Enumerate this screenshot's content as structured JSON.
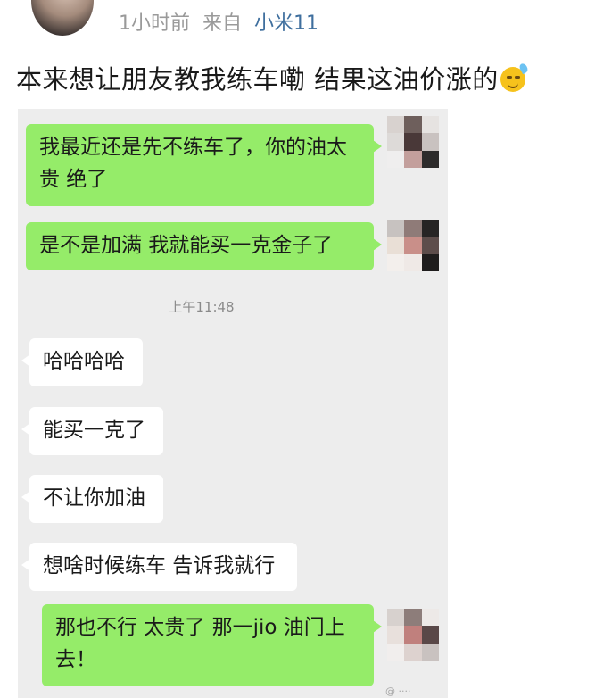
{
  "post": {
    "time": "1小时前",
    "source_prefix": "来自",
    "device": "小米11",
    "text": "本来想让朋友教我练车嘞 结果这油价涨的"
  },
  "chat": {
    "messages": [
      {
        "sender": "me",
        "text": "我最近还是先不练车了，你的油太贵 绝了"
      },
      {
        "sender": "me",
        "text": "是不是加满 我就能买一克金子了"
      },
      {
        "sender": "other",
        "text": "哈哈哈哈"
      },
      {
        "sender": "other",
        "text": "能买一克了"
      },
      {
        "sender": "other",
        "text": "不让你加油"
      },
      {
        "sender": "other",
        "text": "想啥时候练车 告诉我就行"
      },
      {
        "sender": "me",
        "text": "那也不行 太贵了 那一jio 油门上去！"
      }
    ],
    "timestamp": "上午11:48"
  },
  "icons": {
    "emoji": "sweat-smile-emoji",
    "avatar": "user-avatar"
  },
  "colors": {
    "my_bubble": "#95ec69",
    "their_bubble": "#ffffff",
    "chat_background": "#ededed",
    "device_link": "#3f6f9e"
  }
}
